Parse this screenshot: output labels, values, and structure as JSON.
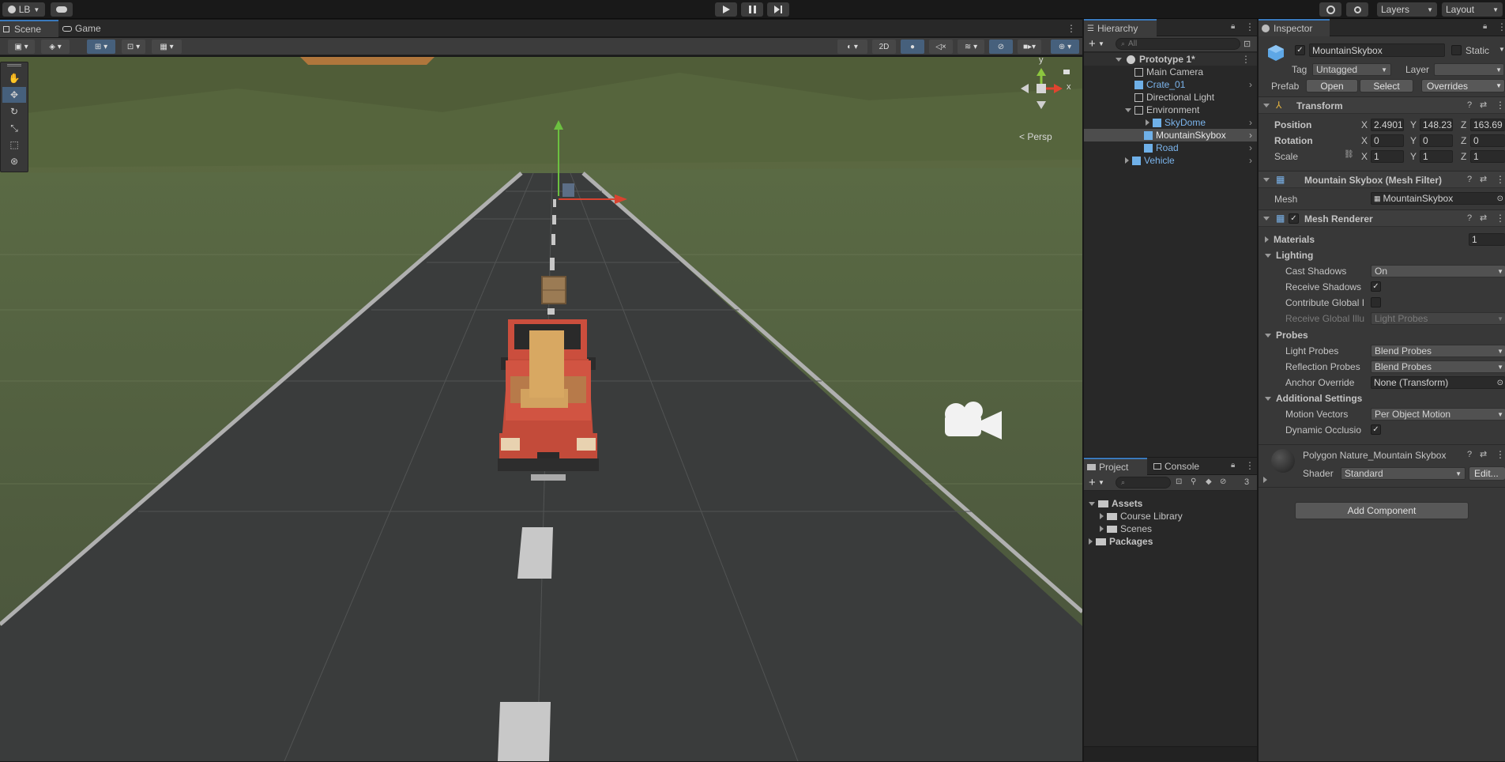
{
  "topbar": {
    "account_label": "LB",
    "cloud_icon": "cloud-icon",
    "history_icon": "history-icon",
    "search_icon": "search-icon",
    "layers_label": "Layers",
    "layout_label": "Layout",
    "play_icon": "play-icon",
    "pause_icon": "pause-icon",
    "step_icon": "step-icon"
  },
  "scene_tabs": {
    "scene_label": "Scene",
    "game_label": "Game"
  },
  "scene_toolbar": {
    "mode_2d_label": "2D"
  },
  "scene_view": {
    "persp_label": "< Persp",
    "gizmo_y": "y",
    "gizmo_x": "x"
  },
  "hierarchy": {
    "tab_label": "Hierarchy",
    "search_placeholder": "All",
    "root": "Prototype 1*",
    "items": [
      {
        "label": "Main Camera",
        "prefab": false
      },
      {
        "label": "Crate_01",
        "prefab": true
      },
      {
        "label": "Directional Light",
        "prefab": false
      },
      {
        "label": "Environment",
        "prefab": false
      },
      {
        "label": "SkyDome",
        "prefab": true
      },
      {
        "label": "MountainSkybox",
        "prefab": true
      },
      {
        "label": "Road",
        "prefab": true
      },
      {
        "label": "Vehicle",
        "prefab": true
      }
    ]
  },
  "project": {
    "project_tab": "Project",
    "console_tab": "Console",
    "hidden_count": "3",
    "tree": [
      "Assets",
      "Course Library",
      "Scenes",
      "Packages"
    ]
  },
  "inspector": {
    "tab_label": "Inspector",
    "object_name": "MountainSkybox",
    "static_label": "Static",
    "tag_label": "Tag",
    "tag_value": "Untagged",
    "layer_label": "Layer",
    "prefab_label": "Prefab",
    "open_btn": "Open",
    "select_btn": "Select",
    "overrides_btn": "Overrides",
    "transform": {
      "title": "Transform",
      "position_label": "Position",
      "rotation_label": "Rotation",
      "scale_label": "Scale",
      "position": {
        "x": "2.4901",
        "y": "148.23",
        "z": "163.69"
      },
      "rotation": {
        "x": "0",
        "y": "0",
        "z": "0"
      },
      "scale": {
        "x": "1",
        "y": "1",
        "z": "1"
      }
    },
    "mesh_filter": {
      "title": "Mountain Skybox (Mesh Filter)",
      "mesh_label": "Mesh",
      "mesh_value": "MountainSkybox"
    },
    "mesh_renderer": {
      "title": "Mesh Renderer",
      "materials_label": "Materials",
      "materials_count": "1",
      "lighting_label": "Lighting",
      "cast_shadows_label": "Cast Shadows",
      "cast_shadows_value": "On",
      "receive_shadows_label": "Receive Shadows",
      "contribute_gi_label": "Contribute Global I",
      "receive_gi_label": "Receive Global Illu",
      "receive_gi_value": "Light Probes",
      "probes_label": "Probes",
      "light_probes_label": "Light Probes",
      "light_probes_value": "Blend Probes",
      "reflection_probes_label": "Reflection Probes",
      "reflection_probes_value": "Blend Probes",
      "anchor_override_label": "Anchor Override",
      "anchor_override_value": "None (Transform)",
      "additional_label": "Additional Settings",
      "motion_vectors_label": "Motion Vectors",
      "motion_vectors_value": "Per Object Motion",
      "dynamic_occlusion_label": "Dynamic Occlusio"
    },
    "material": {
      "name": "Polygon Nature_Mountain Skybox",
      "shader_label": "Shader",
      "shader_value": "Standard",
      "edit_btn": "Edit..."
    },
    "add_component": "Add Component"
  },
  "colors": {
    "accent_blue": "#3a79bb",
    "prefab_blue": "#7bb4ec",
    "panel_bg": "#383838",
    "sky_green": "#5b6a43"
  }
}
